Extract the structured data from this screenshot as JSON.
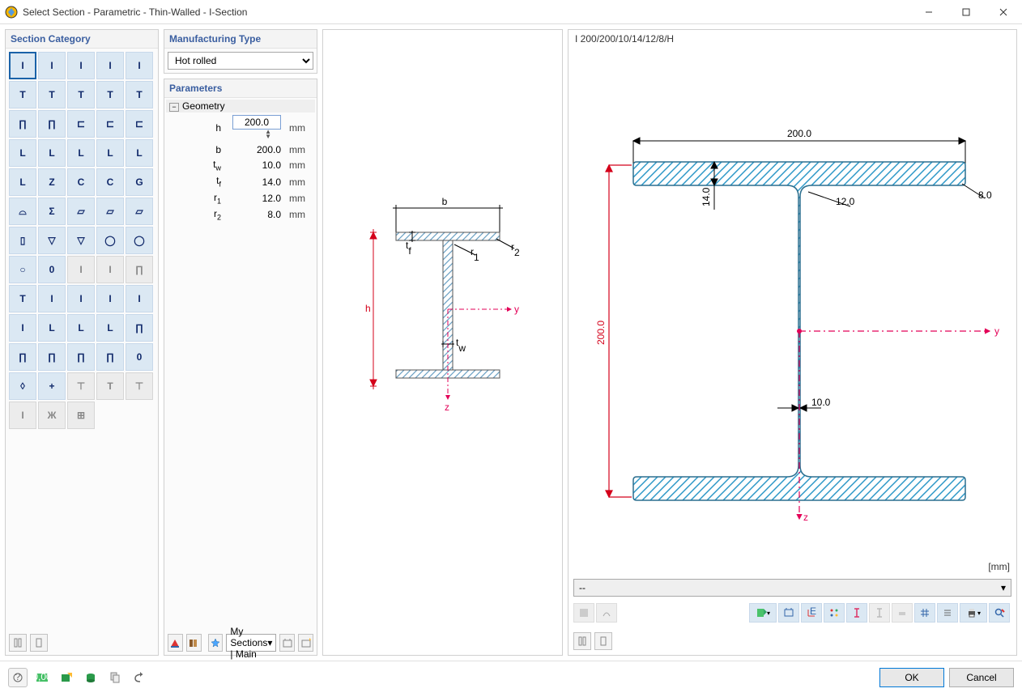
{
  "window": {
    "title": "Select Section - Parametric - Thin-Walled - I-Section"
  },
  "left": {
    "header": "Section Category",
    "items": [
      {
        "g": "I",
        "sel": true
      },
      {
        "g": "I"
      },
      {
        "g": "I"
      },
      {
        "g": "I"
      },
      {
        "g": "I"
      },
      {
        "g": "T"
      },
      {
        "g": "T"
      },
      {
        "g": "T"
      },
      {
        "g": "T"
      },
      {
        "g": "T"
      },
      {
        "g": "∏"
      },
      {
        "g": "∏"
      },
      {
        "g": "⊏"
      },
      {
        "g": "⊏"
      },
      {
        "g": "⊏"
      },
      {
        "g": "L"
      },
      {
        "g": "L"
      },
      {
        "g": "L"
      },
      {
        "g": "L"
      },
      {
        "g": "L"
      },
      {
        "g": "L"
      },
      {
        "g": "Z"
      },
      {
        "g": "C"
      },
      {
        "g": "C"
      },
      {
        "g": "G"
      },
      {
        "g": "⌓"
      },
      {
        "g": "Σ"
      },
      {
        "g": "▱"
      },
      {
        "g": "▱"
      },
      {
        "g": "▱"
      },
      {
        "g": "▯"
      },
      {
        "g": "▽"
      },
      {
        "g": "▽"
      },
      {
        "g": "◯"
      },
      {
        "g": "◯"
      },
      {
        "g": "○"
      },
      {
        "g": "0"
      },
      {
        "g": "I",
        "dis": true
      },
      {
        "g": "I",
        "dis": true
      },
      {
        "g": "",
        "dis": true,
        "empty": true
      },
      {
        "g": "∏",
        "dis": true
      },
      {
        "g": "T"
      },
      {
        "g": "I"
      },
      {
        "g": "I"
      },
      {
        "g": "I"
      },
      {
        "g": "I"
      },
      {
        "g": "I"
      },
      {
        "g": "L"
      },
      {
        "g": "L"
      },
      {
        "g": "L"
      },
      {
        "g": "∏"
      },
      {
        "g": "∏"
      },
      {
        "g": "∏"
      },
      {
        "g": "∏"
      },
      {
        "g": "∏"
      },
      {
        "g": "0"
      },
      {
        "g": "◊"
      },
      {
        "g": "+"
      },
      {
        "g": "⊤",
        "dis": true
      },
      {
        "g": "",
        "dis": true,
        "empty": true
      },
      {
        "g": "T",
        "dis": true
      },
      {
        "g": "⊤",
        "dis": true
      },
      {
        "g": "I",
        "dis": true
      },
      {
        "g": "Ж",
        "dis": true
      },
      {
        "g": "",
        "dis": true,
        "empty": true
      },
      {
        "g": "⊞",
        "dis": true
      }
    ]
  },
  "mid": {
    "mfg_header": "Manufacturing Type",
    "mfg_value": "Hot rolled",
    "param_header": "Parameters",
    "geom_label": "Geometry",
    "params": [
      {
        "name": "h",
        "value": "200.0",
        "unit": "mm",
        "edit": true
      },
      {
        "name": "b",
        "value": "200.0",
        "unit": "mm"
      },
      {
        "name": "t",
        "sub": "w",
        "value": "10.0",
        "unit": "mm"
      },
      {
        "name": "t",
        "sub": "f",
        "value": "14.0",
        "unit": "mm"
      },
      {
        "name": "r",
        "sub": "1",
        "value": "12.0",
        "unit": "mm"
      },
      {
        "name": "r",
        "sub": "2",
        "value": "8.0",
        "unit": "mm"
      }
    ],
    "combo": "My Sections | Main"
  },
  "diag": {
    "labels": {
      "b": "b",
      "h": "h",
      "tf": "t",
      "tf_sub": "f",
      "tw": "t",
      "tw_sub": "w",
      "r1": "r",
      "r1_sub": "1",
      "r2": "r",
      "r2_sub": "2",
      "y": "y",
      "z": "z"
    }
  },
  "right": {
    "header": "I 200/200/10/14/12/8/H",
    "unit": "[mm]",
    "combo": "--",
    "dims": {
      "b": "200.0",
      "h": "200.0",
      "tf": "14.0",
      "tw": "10.0",
      "r1": "12.0",
      "r2": "8.0",
      "y": "y",
      "z": "z"
    }
  },
  "buttons": {
    "ok": "OK",
    "cancel": "Cancel"
  }
}
